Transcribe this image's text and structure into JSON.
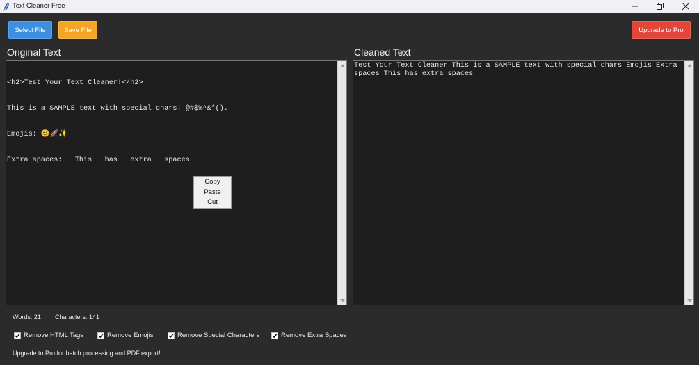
{
  "window": {
    "title": "Text Cleaner Free",
    "icon": "feather-icon"
  },
  "toolbar": {
    "select_label": "Select File",
    "save_label": "Save File",
    "upgrade_label": "Upgrade to Pro",
    "colors": {
      "select": "#3d8fe0",
      "save": "#f5a524",
      "upgrade": "#e2453a"
    }
  },
  "original": {
    "label": "Original Text",
    "lines": [
      "<h2>Test Your Text Cleaner!</h2>",
      "This is a SAMPLE text with special chars: @#$%^&*().",
      "Emojis: 😊🚀✨",
      "Extra spaces:   This   has   extra   spaces"
    ]
  },
  "cleaned": {
    "label": "Cleaned Text",
    "text": "Test Your Text Cleaner This is a SAMPLE text with special chars Emojis Extra spaces This has extra spaces"
  },
  "context_menu": {
    "items": [
      "Copy",
      "Paste",
      "Cut"
    ]
  },
  "stats": {
    "words": "Words: 21",
    "characters": "Characters: 141"
  },
  "options": [
    {
      "label": "Remove HTML Tags",
      "checked": true
    },
    {
      "label": "Remove Emojis",
      "checked": true
    },
    {
      "label": "Remove Special Characters",
      "checked": true
    },
    {
      "label": "Remove Extra Spaces",
      "checked": true
    }
  ],
  "promo": "Upgrade to Pro for batch processing and PDF export!"
}
